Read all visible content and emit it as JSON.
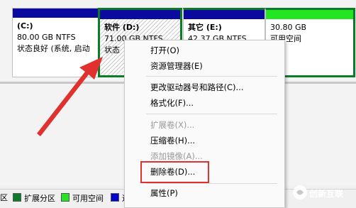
{
  "partitions": [
    {
      "name": "(C:)",
      "size": "80.00 GB NTFS",
      "status": "状态良好 (系统, 启动"
    },
    {
      "name": "软件  (D:)",
      "size": "71.00 GB NTFS",
      "status": "状态"
    },
    {
      "name": "其它  (E:)",
      "size": "42.37 GB NTFS",
      "status": ""
    },
    {
      "name": "",
      "size": "30.80 GB",
      "status": "可用空间"
    }
  ],
  "context_menu": {
    "items": [
      {
        "label": "打开(O)",
        "enabled": true
      },
      {
        "label": "资源管理器(E)",
        "enabled": true
      },
      {
        "label": "更改驱动器号和路径(C)...",
        "enabled": true
      },
      {
        "label": "格式化(F)...",
        "enabled": true
      },
      {
        "label": "扩展卷(X)...",
        "enabled": false
      },
      {
        "label": "压缩卷(H)...",
        "enabled": true
      },
      {
        "label": "添加镜像(A)...",
        "enabled": false
      },
      {
        "label": "删除卷(D)...",
        "enabled": true,
        "highlighted": true
      },
      {
        "label": "属性(P)",
        "enabled": true
      }
    ]
  },
  "legend": [
    {
      "label": "区",
      "color": "#0a0a9e"
    },
    {
      "label": "扩展分区",
      "color": "#0c7c2a"
    },
    {
      "label": "可用空间",
      "color": "#22e622"
    },
    {
      "label": "逻",
      "color": "#0000d0"
    }
  ],
  "watermark": {
    "text": "创新互联"
  },
  "colors": {
    "primary_bar": "#0a0a9e",
    "free_bar": "#22e622",
    "extended_border": "#0c7c2a",
    "annotation": "#e0312f"
  }
}
